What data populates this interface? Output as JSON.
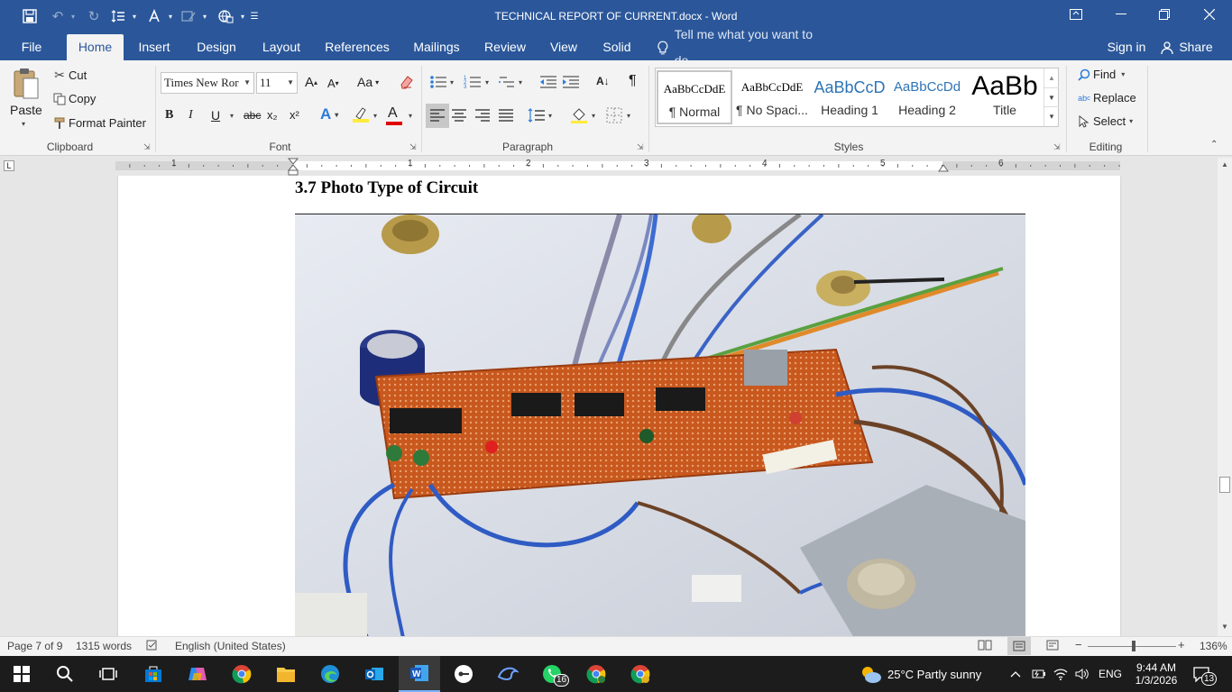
{
  "window": {
    "title": "TECHNICAL REPORT OF CURRENT.docx - Word"
  },
  "tabs": {
    "file": "File",
    "home": "Home",
    "insert": "Insert",
    "design": "Design",
    "layout": "Layout",
    "references": "References",
    "mailings": "Mailings",
    "review": "Review",
    "view": "View",
    "solid": "Solid",
    "tell_me": "Tell me what you want to do...",
    "sign_in": "Sign in",
    "share": "Share"
  },
  "clipboard": {
    "paste": "Paste",
    "cut": "Cut",
    "copy": "Copy",
    "format_painter": "Format Painter",
    "label": "Clipboard"
  },
  "font": {
    "name": "Times New Ror",
    "size": "11",
    "label": "Font",
    "bold": "B",
    "italic": "I",
    "underline": "U",
    "strike": "abc",
    "subscript": "x₂",
    "superscript": "x²",
    "grow": "A",
    "shrink": "A",
    "case": "Aa",
    "effects": "A",
    "color_letter": "A",
    "highlight_color": "#ffeb3b",
    "font_color": "#e00000"
  },
  "paragraph": {
    "label": "Paragraph",
    "pilcrow": "¶",
    "sort": "A↓"
  },
  "styles": {
    "label": "Styles",
    "items": [
      {
        "preview": "AaBbCcDdE",
        "name": "¶ Normal"
      },
      {
        "preview": "AaBbCcDdE",
        "name": "¶ No Spaci..."
      },
      {
        "preview": "AaBbCcD",
        "name": "Heading 1"
      },
      {
        "preview": "AaBbCcDd",
        "name": "Heading 2"
      },
      {
        "preview": "AaBb",
        "name": "Title"
      }
    ],
    "heading_color": "#2e74b5"
  },
  "editing": {
    "find": "Find",
    "replace": "Replace",
    "select": "Select",
    "label": "Editing"
  },
  "ruler": {
    "numbers": [
      "1",
      "1",
      "2",
      "3",
      "4",
      "5",
      "6"
    ]
  },
  "document": {
    "heading": "3.7  Photo Type of Circuit"
  },
  "status": {
    "page": "Page 7 of 9",
    "words": "1315 words",
    "language": "English (United States)",
    "zoom": "136%",
    "zoom_minus": "−",
    "zoom_plus": "+"
  },
  "taskbar": {
    "whatsapp_badge": "16",
    "weather": "25°C  Partly sunny",
    "lang": "ENG",
    "time": "9:44 AM",
    "date": "1/3/2026",
    "notif_count": "13"
  }
}
